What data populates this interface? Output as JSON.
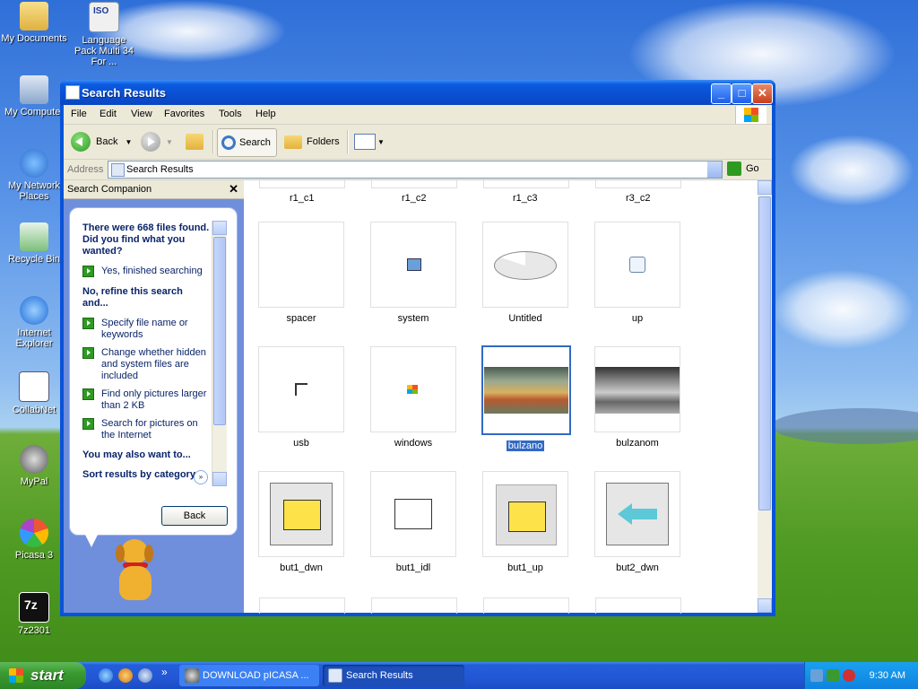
{
  "desktop": {
    "icons": [
      {
        "label": "My Documents"
      },
      {
        "label": "Language Pack Multi 34 For ..."
      },
      {
        "label": "My Computer"
      },
      {
        "label": "My Network Places"
      },
      {
        "label": "Recycle Bin"
      },
      {
        "label": "Internet Explorer"
      },
      {
        "label": "CollabNet"
      },
      {
        "label": "MyPal"
      },
      {
        "label": "Picasa 3"
      },
      {
        "label": "7z2301"
      }
    ],
    "iso_badge": "ISO",
    "sevenzip_badge": "7z"
  },
  "window": {
    "title": "Search Results",
    "menu": [
      "File",
      "Edit",
      "View",
      "Favorites",
      "Tools",
      "Help"
    ],
    "toolbar": {
      "back": "Back",
      "search": "Search",
      "folders": "Folders"
    },
    "address": {
      "label": "Address",
      "value": "Search Results",
      "go": "Go"
    },
    "controls": {
      "minimize": "_",
      "maximize": "□",
      "close": "✕"
    }
  },
  "companion": {
    "header": "Search Companion",
    "close": "✕",
    "found": "There were 668 files found. Did you find what you wanted?",
    "yes": "Yes, finished searching",
    "refine": "No, refine this search and...",
    "options": [
      "Specify file name or keywords",
      "Change whether hidden and system files are included",
      "Find only pictures larger than 2 KB",
      "Search for pictures on the Internet"
    ],
    "also": "You may also want to...",
    "sort": "Sort results by category",
    "back_button": "Back"
  },
  "results": {
    "top_row": [
      "r1_c1",
      "r1_c2",
      "r1_c3",
      "r3_c2"
    ],
    "rows": [
      [
        {
          "name": "spacer"
        },
        {
          "name": "system"
        },
        {
          "name": "Untitled"
        },
        {
          "name": "up"
        }
      ],
      [
        {
          "name": "usb"
        },
        {
          "name": "windows"
        },
        {
          "name": "bulzano",
          "selected": true
        },
        {
          "name": "bulzanom"
        }
      ],
      [
        {
          "name": "but1_dwn"
        },
        {
          "name": "but1_idl"
        },
        {
          "name": "but1_up"
        },
        {
          "name": "but2_dwn"
        }
      ]
    ]
  },
  "taskbar": {
    "start": "start",
    "tasks": [
      {
        "label": "DOWNLOAD pICASA ..."
      },
      {
        "label": "Search Results",
        "active": true
      }
    ],
    "clock": "9:30 AM",
    "overflow": "»"
  },
  "colors": {
    "selection": "#316ac5",
    "titlebar": "#0a4fd2",
    "start": "#3a9a30"
  }
}
